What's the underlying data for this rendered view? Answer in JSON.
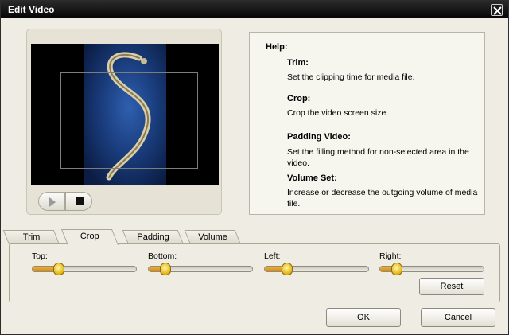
{
  "window": {
    "title": "Edit Video"
  },
  "player": {
    "play_icon": "play-icon",
    "stop_icon": "stop-icon"
  },
  "help": {
    "title": "Help:",
    "items": [
      {
        "heading": "Trim:",
        "text": "Set the clipping time for media file."
      },
      {
        "heading": "Crop:",
        "text": "Crop the video screen size."
      },
      {
        "heading": "Padding Video:",
        "text": "Set the filling method for non-selected area in the video."
      },
      {
        "heading": "Volume Set:",
        "text": "Increase or decrease the outgoing volume of media file."
      }
    ]
  },
  "tabs": [
    {
      "label": "Trim",
      "active": false
    },
    {
      "label": "Crop",
      "active": true
    },
    {
      "label": "Padding",
      "active": false
    },
    {
      "label": "Volume",
      "active": false
    }
  ],
  "crop": {
    "sliders": [
      {
        "label": "Top:",
        "value_fraction": 0.22
      },
      {
        "label": "Bottom:",
        "value_fraction": 0.12
      },
      {
        "label": "Left:",
        "value_fraction": 0.18
      },
      {
        "label": "Right:",
        "value_fraction": 0.12
      }
    ],
    "reset_label": "Reset"
  },
  "buttons": {
    "ok_label": "OK",
    "cancel_label": "Cancel"
  },
  "colors": {
    "accent": "#e8a020",
    "titlebar": "#0a0a0a",
    "background": "#efede3"
  }
}
